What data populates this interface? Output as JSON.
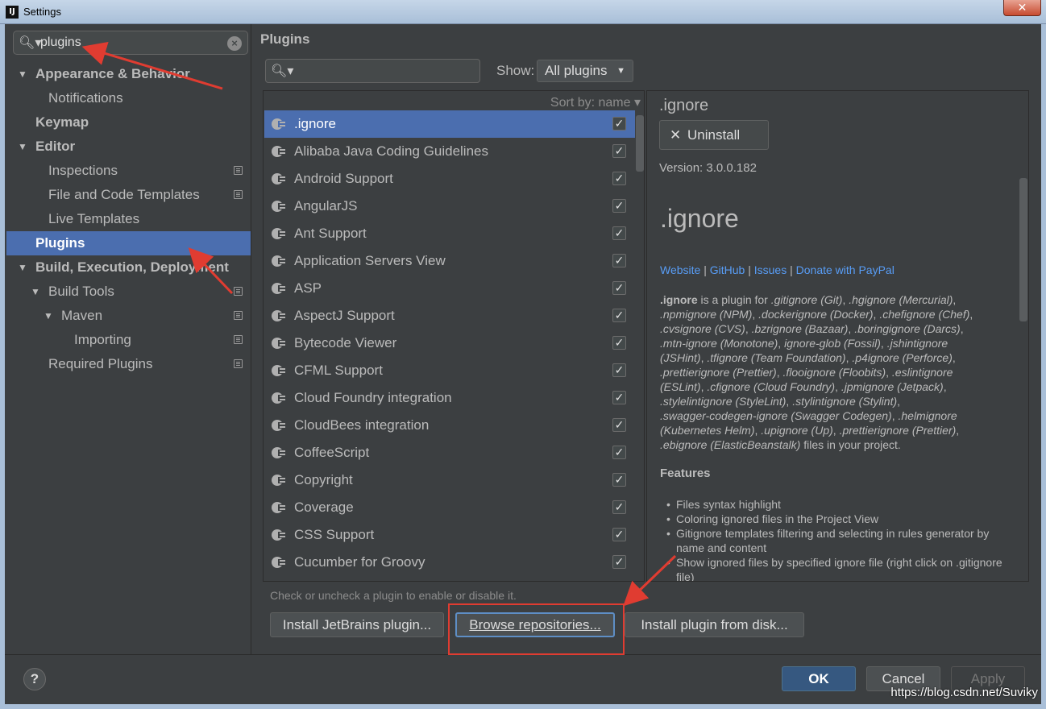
{
  "window": {
    "title": "Settings",
    "app_icon_text": "IJ",
    "close_glyph": "✕"
  },
  "sidebar": {
    "search": {
      "value": "plugins",
      "icon": "search-icon",
      "clear_glyph": "×"
    },
    "items": [
      {
        "label": "Appearance & Behavior",
        "bold": true,
        "arrow": "▼"
      },
      {
        "label": "Notifications",
        "bold": false
      },
      {
        "label": "Keymap",
        "bold": true
      },
      {
        "label": "Editor",
        "bold": true,
        "arrow": "▼"
      },
      {
        "label": "Inspections",
        "bold": false,
        "copy": true
      },
      {
        "label": "File and Code Templates",
        "bold": false,
        "copy": true
      },
      {
        "label": "Live Templates",
        "bold": false
      },
      {
        "label": "Plugins",
        "bold": true,
        "selected": true
      },
      {
        "label": "Build, Execution, Deployment",
        "bold": true,
        "arrow": "▼"
      },
      {
        "label": "Build Tools",
        "bold": false,
        "arrow": "▼",
        "copy": true
      },
      {
        "label": "Maven",
        "bold": false,
        "arrow": "▼",
        "copy": true
      },
      {
        "label": "Importing",
        "bold": false,
        "copy": true
      },
      {
        "label": "Required Plugins",
        "bold": false,
        "copy": true
      }
    ]
  },
  "main": {
    "title": "Plugins",
    "show_label": "Show:",
    "show_value": "All plugins",
    "sort_by": "Sort by: name ▾",
    "plugins": [
      {
        "name": ".ignore",
        "checked": true,
        "selected": true
      },
      {
        "name": "Alibaba Java Coding Guidelines",
        "checked": true
      },
      {
        "name": "Android Support",
        "checked": true
      },
      {
        "name": "AngularJS",
        "checked": true
      },
      {
        "name": "Ant Support",
        "checked": true
      },
      {
        "name": "Application Servers View",
        "checked": true
      },
      {
        "name": "ASP",
        "checked": true
      },
      {
        "name": "AspectJ Support",
        "checked": true
      },
      {
        "name": "Bytecode Viewer",
        "checked": true
      },
      {
        "name": "CFML Support",
        "checked": true
      },
      {
        "name": "Cloud Foundry integration",
        "checked": true
      },
      {
        "name": "CloudBees integration",
        "checked": true
      },
      {
        "name": "CoffeeScript",
        "checked": true
      },
      {
        "name": "Copyright",
        "checked": true
      },
      {
        "name": "Coverage",
        "checked": true
      },
      {
        "name": "CSS Support",
        "checked": true
      },
      {
        "name": "Cucumber for Groovy",
        "checked": true
      }
    ],
    "check_glyph": "✓",
    "hint": "Check or uncheck a plugin to enable or disable it.",
    "buttons": {
      "install_jetbrains": "Install JetBrains plugin...",
      "browse": "Browse repositories...",
      "install_disk": "Install plugin from disk..."
    }
  },
  "details": {
    "name": ".ignore",
    "uninstall_label": "Uninstall",
    "version": "Version: 3.0.0.182",
    "big_title": ".ignore",
    "links": [
      "Website",
      "GitHub",
      "Issues",
      "Donate with PayPal"
    ],
    "description_lines": [
      [
        ".ignore",
        " is a plugin for ",
        ".gitignore (Git)",
        ", ",
        ".hgignore (Mercurial)",
        ","
      ],
      [
        ".npmignore (NPM)",
        ", ",
        ".dockerignore (Docker)",
        ", ",
        ".chefignore (Chef)",
        ","
      ],
      [
        ".cvsignore (CVS)",
        ", ",
        ".bzrignore (Bazaar)",
        ", ",
        ".boringignore (Darcs)",
        ","
      ],
      [
        ".mtn-ignore (Monotone)",
        ", ",
        "ignore-glob (Fossil)",
        ", ",
        ".jshintignore",
        ""
      ],
      [
        "(JSHint)",
        ", ",
        ".tfignore (Team Foundation)",
        ", ",
        ".p4ignore (Perforce)",
        ","
      ],
      [
        ".prettierignore (Prettier)",
        ", ",
        ".flooignore (Floobits)",
        ", ",
        ".eslintignore",
        ""
      ],
      [
        "(ESLint)",
        ", ",
        ".cfignore (Cloud Foundry)",
        ", ",
        ".jpmignore (Jetpack)",
        ","
      ],
      [
        ".stylelintignore (StyleLint)",
        ", ",
        ".stylintignore (Stylint)",
        ",",
        "",
        ""
      ],
      [
        ".swagger-codegen-ignore (Swagger Codegen)",
        ", ",
        ".helmignore",
        "",
        "",
        ""
      ],
      [
        "(Kubernetes Helm)",
        ", ",
        ".upignore (Up)",
        ", ",
        ".prettierignore (Prettier)",
        ","
      ],
      [
        ".ebignore (ElasticBeanstalk)",
        " files in your project.",
        "",
        "",
        "",
        ""
      ]
    ],
    "features_title": "Features",
    "features": [
      "Files syntax highlight",
      "Coloring ignored files in the Project View",
      "Gitignore templates filtering and selecting in rules generator by name and content",
      "Show ignored files by specified ignore file (right click on .gitignore file)"
    ],
    "bullet": "•"
  },
  "footer": {
    "help": "?",
    "ok": "OK",
    "cancel": "Cancel",
    "apply": "Apply",
    "watermark": "https://blog.csdn.net/Suviky"
  },
  "colors": {
    "background": "#3c3f41",
    "selection": "#4b6eaf",
    "link": "#589df6",
    "annotation": "#e03c31"
  }
}
